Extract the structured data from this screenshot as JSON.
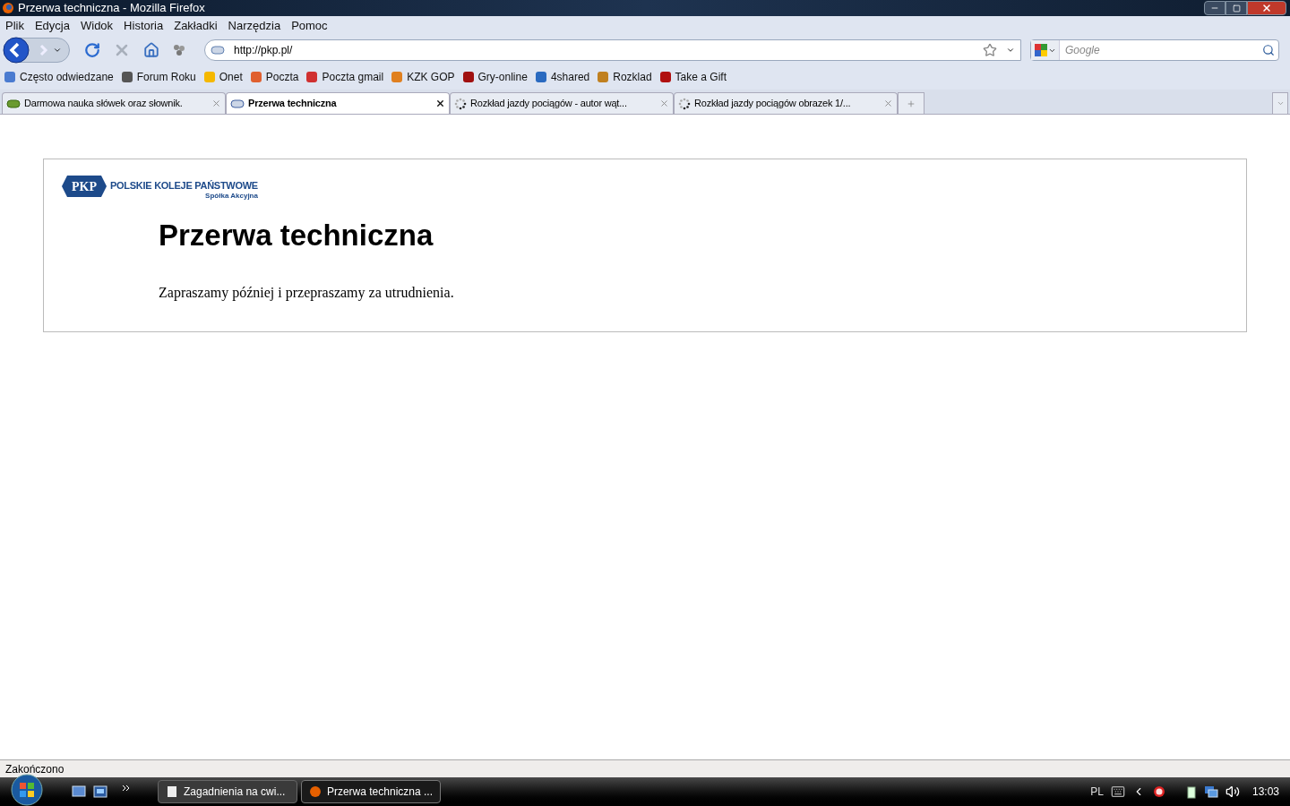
{
  "window": {
    "title": "Przerwa techniczna - Mozilla Firefox"
  },
  "menu": [
    "Plik",
    "Edycja",
    "Widok",
    "Historia",
    "Zakładki",
    "Narzędzia",
    "Pomoc"
  ],
  "address_bar": {
    "value": "http://pkp.pl/"
  },
  "search": {
    "placeholder": "Google"
  },
  "bookmarks": [
    "Często odwiedzane",
    "Forum Roku",
    "Onet",
    "Poczta",
    "Poczta gmail",
    "KZK GOP",
    "Gry-online",
    "4shared",
    "Rozklad",
    "Take a Gift"
  ],
  "tabs": [
    {
      "label": "Darmowa nauka słówek oraz słownik.",
      "selected": false,
      "loading": false
    },
    {
      "label": "Przerwa techniczna",
      "selected": true,
      "loading": false
    },
    {
      "label": "Rozkład jazdy pociągów - autor wąt...",
      "selected": false,
      "loading": true
    },
    {
      "label": "Rozkład jazdy pociągów obrazek 1/...",
      "selected": false,
      "loading": true
    }
  ],
  "page": {
    "logo": {
      "mark": "PKP",
      "name": "POLSKIE KOLEJE PAŃSTWOWE",
      "subtitle": "Spółka Akcyjna"
    },
    "heading": "Przerwa techniczna",
    "message": "Zapraszamy później i przepraszamy za utrudnienia."
  },
  "status_bar": {
    "text": "Zakończono"
  },
  "taskbar": {
    "buttons": [
      {
        "label": "Zagadnienia na cwi...",
        "selected": false
      },
      {
        "label": "Przerwa techniczna ...",
        "selected": true
      }
    ],
    "tray": {
      "language": "PL",
      "clock": "13:03"
    }
  }
}
